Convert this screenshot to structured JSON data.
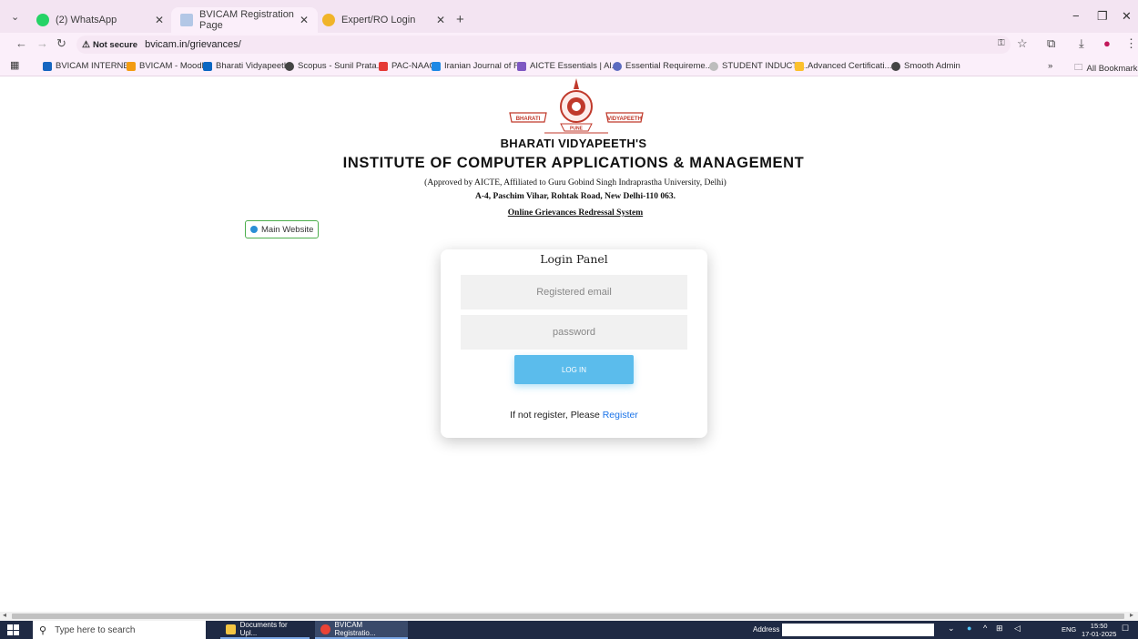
{
  "tabs": [
    {
      "title": "(2) WhatsApp",
      "icon": "whatsapp-icon",
      "active": false
    },
    {
      "title": "BVICAM Registration Page",
      "icon": "page-icon",
      "active": true
    },
    {
      "title": "Expert/RO Login",
      "icon": "globe-icon",
      "active": false
    }
  ],
  "toolbar": {
    "security_label": "Not secure",
    "url": "bvicam.in/grievances/"
  },
  "bookmarks": [
    "BVICAM INTERNET",
    "BVICAM - Moodle",
    "Bharati Vidyapeeth",
    "Scopus - Sunil Prata...",
    "PAC-NAAC",
    "Iranian Journal of F...",
    "AICTE Essentials | Al...",
    "Essential Requireme...",
    "STUDENT INDUCTI...",
    "Advanced Certificati...",
    "Smooth Admin"
  ],
  "bookmarks_more": "»",
  "bookmarks_all": "All Bookmarks",
  "logo": {
    "left_text": "BHARATI",
    "right_text": "VIDYAPEETH",
    "bottom_text": "PUNE"
  },
  "header": {
    "line1": "BHARATI VIDYAPEETH'S",
    "line2": "INSTITUTE OF COMPUTER APPLICATIONS & MANAGEMENT",
    "approval": "(Approved by AICTE, Affiliated to Guru Gobind Singh Indraprastha University, Delhi)",
    "address": "A-4, Paschim Vihar, Rohtak Road, New Delhi-110 063.",
    "system": "Online Grievances Redressal System"
  },
  "main_website": "Main Website",
  "login": {
    "title": "Login Panel",
    "email_placeholder": "Registered email",
    "password_placeholder": "password",
    "button": "LOG IN",
    "register_prefix": "If not register, Please ",
    "register_link": "Register"
  },
  "taskbar": {
    "search_placeholder": "Type here to search",
    "items": [
      "Documents for Upl...",
      "BVICAM Registratio..."
    ],
    "address_label": "Address",
    "language": "ENG",
    "time": "15:50",
    "date": "17-01-2025"
  },
  "colors": {
    "tabbar_bg": "#f3e4f2",
    "toolbar_bg": "#fbeffa",
    "login_button": "#5bbcec",
    "link": "#1a73e8",
    "taskbar_bg": "#1f2a44"
  }
}
